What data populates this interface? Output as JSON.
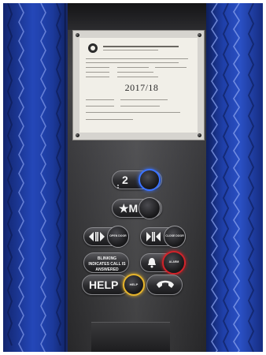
{
  "scene": {
    "subject": "elevator-control-panel",
    "colors": {
      "pad_blue": "#2447b8",
      "panel_steel": "#2f2f32",
      "floor_ring_blue": "#3b73ff",
      "alarm_ring_red": "#d2232a",
      "help_ring_yellow": "#e7b52c"
    }
  },
  "certificate": {
    "year": "2017/18",
    "emblem_icon": "government-seal-icon"
  },
  "buttons": {
    "floor_label": "2",
    "main_label": "★M",
    "open_label": "OPEN DOOR",
    "close_label": "CLOSE DOOR",
    "blink_notice": "BLINKING INDICATES CALL IS ANSWERED",
    "alarm_label": "ALARM",
    "help_label": "HELP",
    "help_button_label": "HELP"
  }
}
